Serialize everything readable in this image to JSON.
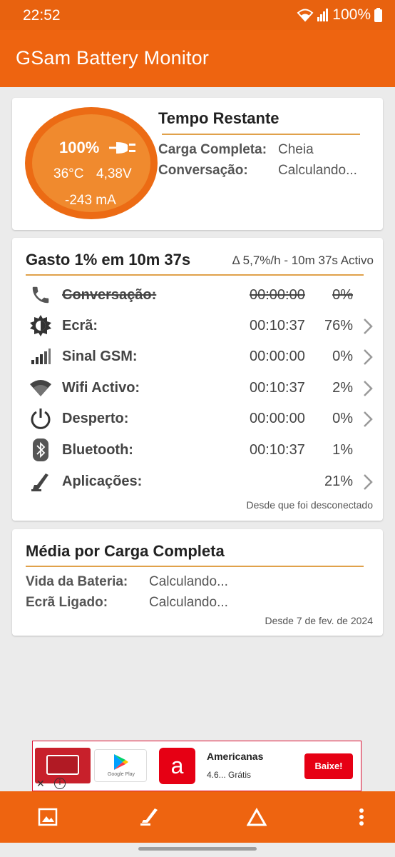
{
  "status_bar": {
    "time": "22:52",
    "battery_text": "100%"
  },
  "app_bar": {
    "title": "GSam Battery Monitor"
  },
  "gauge": {
    "percent": "100%",
    "temperature": "36°C",
    "voltage": "4,38V",
    "current": "-243 mA",
    "plug_icon": "plug-icon"
  },
  "remaining": {
    "heading": "Tempo Restante",
    "rows": [
      {
        "label": "Carga Completa:",
        "value": "Cheia"
      },
      {
        "label": "Conversação:",
        "value": "Calculando..."
      }
    ]
  },
  "usage": {
    "heading": "Gasto 1% em 10m 37s",
    "rate": "Δ 5,7%/h - 10m 37s Activo",
    "rows": [
      {
        "icon": "phone-icon",
        "label": "Conversação:",
        "time": "00:00:00",
        "percent": "0%",
        "strike": true,
        "chevron": false
      },
      {
        "icon": "screen-brightness-icon",
        "label": "Ecrã:",
        "time": "00:10:37",
        "percent": "76%",
        "strike": false,
        "chevron": true
      },
      {
        "icon": "signal-icon",
        "label": "Sinal GSM:",
        "time": "00:00:00",
        "percent": "0%",
        "strike": false,
        "chevron": true
      },
      {
        "icon": "wifi-icon",
        "label": "Wifi Activo:",
        "time": "00:10:37",
        "percent": "2%",
        "strike": false,
        "chevron": true
      },
      {
        "icon": "power-icon",
        "label": "Desperto:",
        "time": "00:00:00",
        "percent": "0%",
        "strike": false,
        "chevron": true
      },
      {
        "icon": "bluetooth-icon",
        "label": "Bluetooth:",
        "time": "00:10:37",
        "percent": "1%",
        "strike": false,
        "chevron": false
      },
      {
        "icon": "apps-icon",
        "label": "Aplicações:",
        "time": "",
        "percent": "21%",
        "strike": false,
        "chevron": true
      }
    ],
    "footnote": "Desde que foi desconectado"
  },
  "average": {
    "heading": "Média por Carga Completa",
    "rows": [
      {
        "label": "Vida da Bateria:",
        "value": "Calculando..."
      },
      {
        "label": "Ecrã Ligado:",
        "value": "Calculando..."
      }
    ],
    "footnote": "Desde 7 de fev. de 2024"
  },
  "ad": {
    "store_text": "Google Play",
    "app_name": "Americanas",
    "app_meta": "4.6...  Grátis",
    "cta": "Baixe!",
    "app_icon_letter": "a"
  },
  "colors": {
    "brand_orange": "#ee6410",
    "gauge_orange": "#f08a2e",
    "accent_rule": "#e0a14a",
    "ad_red": "#e60014"
  }
}
